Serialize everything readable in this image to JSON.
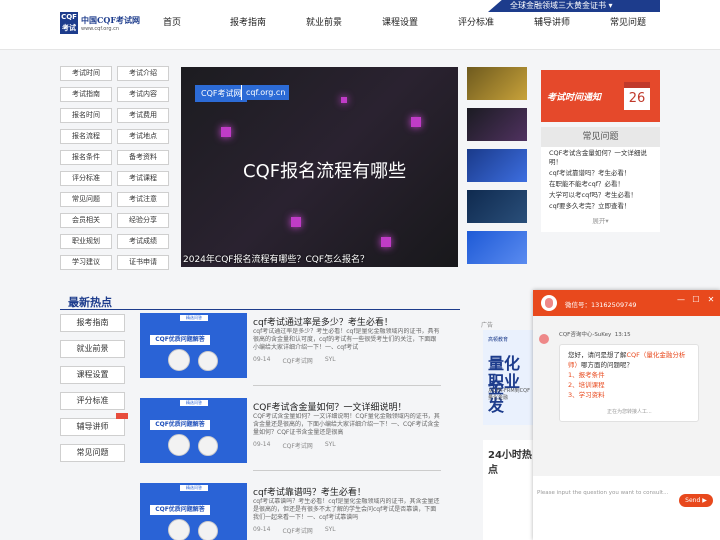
{
  "header": {
    "logo_title": "中国CQF考试网",
    "logo_url": "www.cqf.org.cn",
    "logo_mark": "CQF考试网",
    "nav": [
      "首页",
      "报考指南",
      "就业前景",
      "课程设置",
      "评分标准",
      "辅导讲师",
      "常见问题"
    ],
    "banner": "全球金融领域三大黄金证书"
  },
  "side_grid": [
    "考试时间",
    "考试介绍",
    "考试指南",
    "考试内容",
    "报名时间",
    "考试费用",
    "报名流程",
    "考试地点",
    "报名条件",
    "备考资料",
    "评分标准",
    "考试课程",
    "常见问题",
    "考试注意",
    "会员相关",
    "经验分享",
    "职业规划",
    "考试成绩",
    "学习建议",
    "证书申请"
  ],
  "hero": {
    "tag1": "CQF考试网",
    "tag2": "cqf.org.cn",
    "title": "CQF报名流程有哪些",
    "caption": "2024年CQF报名流程有哪些？CQF怎么报名？"
  },
  "notice": {
    "text": "考试时间通知",
    "day": "26"
  },
  "faq": {
    "title": "常见问题",
    "items": [
      "CQF考试含金量如何？一文详细说明！",
      "cqf考试靠谱吗？考生必看！",
      "在职能不能考cqf？必看！",
      "大学可以考cqf吗？考生必看！",
      "cqf要多久考完？立即查看！"
    ],
    "more": "展开▾"
  },
  "hot": {
    "title": "最新热点",
    "side": [
      "报考指南",
      "就业前景",
      "课程设置",
      "评分标准",
      "辅导讲师",
      "常见问题"
    ],
    "img_band": "CQF优质问题解答",
    "img_head": "精选问答",
    "articles": [
      {
        "title": "cqf考试通过率是多少？考生必看！",
        "desc": "cqf考试通过率是多少？考生必看！cqf是量化金融领域内的证书，具有很高的含金量和认可度，cqf的考试有一些很受考生们的关注，下面跟小编给大家详细介绍一下！一、cqf考试",
        "date": "09-14",
        "site": "CQF考试网",
        "author": "SYL"
      },
      {
        "title": "CQF考试含金量如何？一文详细说明！",
        "desc": "CQF考试含金量如何？一文详细说明！CQF量化金融领域内的证书，其含金量还是很高的，下面小编给大家详细介绍一下！一、CQF考试含金量如何？CQF证书含金量还是很高",
        "date": "09-14",
        "site": "CQF考试网",
        "author": "SYL"
      },
      {
        "title": "cqf考试靠谱吗？考生必看！",
        "desc": "cqf考试靠谱吗？考生必看！cqf是量化金融领域内的证书，其含金量还是很高的，但还是有很多不太了解的学生会问cqf考试是否靠谱，下面我们一起来看一下！一、cqf考试靠谱吗",
        "date": "09-14",
        "site": "CQF考试网",
        "author": "SYL"
      }
    ]
  },
  "ad": {
    "label": "广告",
    "brand": "高顿教育",
    "line1": "量化金",
    "line2": "职业发",
    "small": "从CFA-FRM到CQF量化金融"
  },
  "hot24": {
    "title": "24小时热点"
  },
  "chat": {
    "title": "微信号：13162509749",
    "agent": "CQF咨询中心-SuKey",
    "time": "13:15",
    "greeting": "您好，请问是想了解",
    "greeting_hl": "CQF（量化金融分析师）",
    "greeting_end": "哪方面的问题呢？",
    "options": [
      "1、报考条件",
      "2、培训课程",
      "3、学习资料"
    ],
    "transfer": "正在为您转接人工...",
    "input_placeholder": "Please input the question you want to consult...",
    "send": "Send"
  },
  "colors": {
    "brand": "#1d3c8c",
    "accent": "#e8491d"
  }
}
